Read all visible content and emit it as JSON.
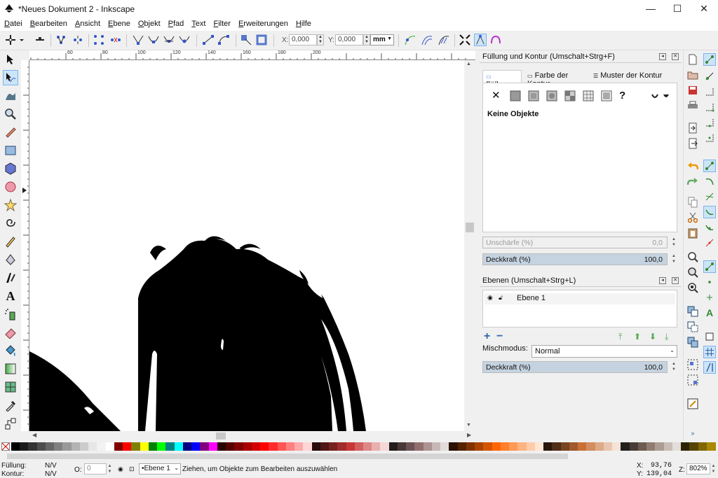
{
  "window": {
    "title": "*Neues Dokument 2 - Inkscape",
    "min_icon": "minimize-icon",
    "max_icon": "maximize-icon",
    "close_icon": "close-icon"
  },
  "menu": [
    "Datei",
    "Bearbeiten",
    "Ansicht",
    "Ebene",
    "Objekt",
    "Pfad",
    "Text",
    "Filter",
    "Erweiterungen",
    "Hilfe"
  ],
  "cmdbar": {
    "x_label": "X:",
    "x_value": "0,000",
    "y_label": "Y:",
    "y_value": "0,000",
    "unit": "mm"
  },
  "tools": [
    "select-tool",
    "node-tool",
    "tweak-tool",
    "zoom-tool",
    "measure-tool",
    "rect-tool",
    "3dbox-tool",
    "ellipse-tool",
    "star-tool",
    "spiral-tool",
    "pencil-tool",
    "pen-tool",
    "calligraphy-tool",
    "text-tool",
    "spray-tool",
    "eraser-tool",
    "paintbucket-tool",
    "gradient-tool",
    "mesh-tool",
    "dropper-tool",
    "connector-tool"
  ],
  "ruler": {
    "marks": [
      "60",
      "80",
      "100",
      "120",
      "140",
      "160",
      "180",
      "200"
    ]
  },
  "fill_panel": {
    "title": "Füllung und Kontur (Umschalt+Strg+F)",
    "tabs": [
      "Füllung",
      "Farbe der Kontur",
      "Muster der Kontur"
    ],
    "unset_icon": "x-icon",
    "unknown_icon": "?",
    "no_objects": "Keine Objekte",
    "blur_label": "Unschärfe (%)",
    "blur_value": "0,0",
    "opacity_label": "Deckkraft (%)",
    "opacity_value": "100,0"
  },
  "layers_panel": {
    "title": "Ebenen (Umschalt+Strg+L)",
    "layer_name": "Ebene 1",
    "blend_label": "Mischmodus:",
    "blend_value": "Normal",
    "opacity_label": "Deckkraft (%)",
    "opacity_value": "100,0"
  },
  "palette_colors": [
    "#000000",
    "#1a1a1a",
    "#333333",
    "#4d4d4d",
    "#666666",
    "#808080",
    "#999999",
    "#b3b3b3",
    "#cccccc",
    "#e6e6e6",
    "#f2f2f2",
    "#ffffff",
    "#800000",
    "#ff0000",
    "#808000",
    "#ffff00",
    "#008000",
    "#00ff00",
    "#008080",
    "#00ffff",
    "#000080",
    "#0000ff",
    "#800080",
    "#ff00ff",
    "#2b0000",
    "#550000",
    "#800000",
    "#aa0000",
    "#d40000",
    "#ff0000",
    "#ff2a2a",
    "#ff5555",
    "#ff8080",
    "#ffaaaa",
    "#ffd5d5",
    "#280b0b",
    "#501616",
    "#782121",
    "#a02c2c",
    "#c83737",
    "#d35f5f",
    "#de8787",
    "#e9afaf",
    "#f4d7d7",
    "#241c1c",
    "#483737",
    "#6c5353",
    "#916f6f",
    "#ac9393",
    "#c8b7b7",
    "#e3dbdb",
    "#2b1100",
    "#552200",
    "#803300",
    "#aa4400",
    "#d45500",
    "#ff6600",
    "#ff7f2a",
    "#ff9955",
    "#ffb380",
    "#ffccaa",
    "#ffe6d5",
    "#28170b",
    "#502d16",
    "#784421",
    "#a05a2c",
    "#c87137",
    "#d38d5f",
    "#deaa87",
    "#e9c6af",
    "#f4e3d7",
    "#241f1c",
    "#483e37",
    "#6c5d53",
    "#917c6f",
    "#ac9d93",
    "#c8beb7",
    "#e3dedb",
    "#2b2200",
    "#554400",
    "#806600",
    "#aa8800"
  ],
  "status": {
    "fill_label": "Füllung:",
    "fill_value": "N/V",
    "stroke_label": "Kontur:",
    "stroke_value": "N/V",
    "o_label": "O:",
    "o_value": "0",
    "layer": "•Ebene 1",
    "message": "Ziehen, um Objekte zum Bearbeiten auszuwählen",
    "x_label": "X:",
    "x_value": "93,76",
    "y_label": "Y:",
    "y_value": "139,04",
    "z_label": "Z:",
    "zoom": "802%"
  },
  "colors": {
    "accent": "#cce4f7",
    "slider_fill": "#c5d3e0"
  }
}
